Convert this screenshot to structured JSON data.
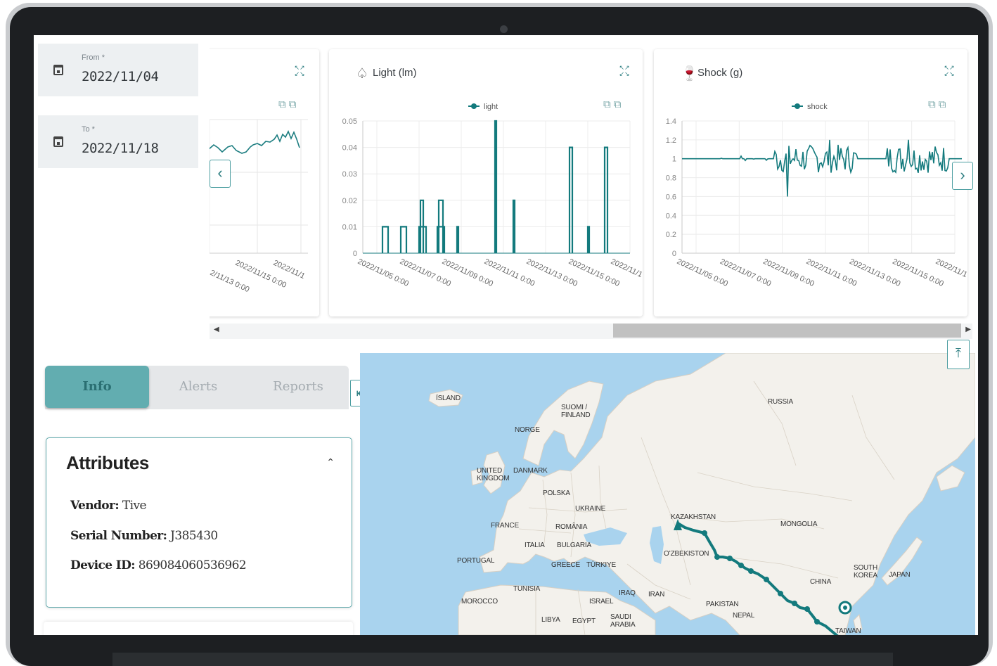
{
  "filters": {
    "from_label": "From *",
    "from_value": "2022/11/04",
    "to_label": "To *",
    "to_value": "2022/11/18"
  },
  "charts": {
    "partial_x_labels": [
      "2/11/13 0:00",
      "2022/11/15 0:00",
      "2022/11/1"
    ],
    "light": {
      "title": "Light (lm)",
      "legend": "light",
      "y_ticks": [
        "0.05",
        "0.04",
        "0.03",
        "0.02",
        "0.01",
        "0"
      ],
      "x_ticks": [
        "2022/11/05 0:00",
        "2022/11/07 0:00",
        "2022/11/09 0:00",
        "2022/11/11 0:00",
        "2022/11/13 0:00",
        "2022/11/15 0:00",
        "2022/11/1"
      ]
    },
    "shock": {
      "title": "Shock (g)",
      "legend": "shock",
      "y_ticks": [
        "1.4",
        "1.2",
        "1",
        "0.8",
        "0.6",
        "0.4",
        "0.2",
        "0"
      ],
      "x_ticks": [
        "2022/11/05 0:00",
        "2022/11/07 0:00",
        "2022/11/09 0:00",
        "2022/11/11 0:00",
        "2022/11/13 0:00",
        "2022/11/15 0:00",
        "2022/11/1"
      ]
    }
  },
  "chart_data": [
    {
      "type": "line",
      "title": "Light (lm)",
      "series": [
        {
          "name": "light",
          "x": [
            "2022/11/05",
            "2022/11/05",
            "2022/11/06",
            "2022/11/06",
            "2022/11/07",
            "2022/11/07",
            "2022/11/08",
            "2022/11/09",
            "2022/11/11",
            "2022/11/12",
            "2022/11/14",
            "2022/11/15",
            "2022/11/16"
          ],
          "values": [
            0.01,
            0.01,
            0.01,
            0.01,
            0.02,
            0.01,
            0.02,
            0.01,
            0.05,
            0.02,
            0.04,
            0.01,
            0.04
          ]
        }
      ],
      "ylim": [
        0,
        0.05
      ]
    },
    {
      "type": "line",
      "title": "Shock (g)",
      "series": [
        {
          "name": "shock",
          "baseline": 1,
          "min": 0.6,
          "max": 1.2
        }
      ],
      "ylim": [
        0,
        1.4
      ]
    }
  ],
  "tabs": [
    "Info",
    "Alerts",
    "Reports"
  ],
  "attributes": {
    "title": "Attributes",
    "vendor_label": "Vendor:",
    "vendor_value": "Tive",
    "serial_label": "Serial Number:",
    "serial_value": "J385430",
    "device_label": "Device ID:",
    "device_value": "869084060536962"
  },
  "map": {
    "labels": [
      "ÍSLAND",
      "SUOMI / FINLAND",
      "NORGE",
      "RUSSIA",
      "UNITED KINGDOM",
      "DANMARK",
      "POLSKA",
      "UKRAINE",
      "FRANCE",
      "ROMÂNIA",
      "KAZAKHSTAN",
      "MONGOLIA",
      "ITALIA",
      "BULGARIA",
      "PORTUGAL",
      "GREECE",
      "TÜRKIYE",
      "OʻZBEKISTON",
      "TUNISIA",
      "IRAQ",
      "IRAN",
      "ISRAEL",
      "MOROCCO",
      "LIBYA",
      "EGYPT",
      "SAUDI ARABIA",
      "PAKISTAN",
      "NEPAL",
      "CHINA",
      "SOUTH KOREA",
      "JAPAN",
      "TAIWAN"
    ],
    "colors": {
      "water": "#a9d3ee",
      "land": "#f3f1ec",
      "route": "#137a7d"
    }
  }
}
